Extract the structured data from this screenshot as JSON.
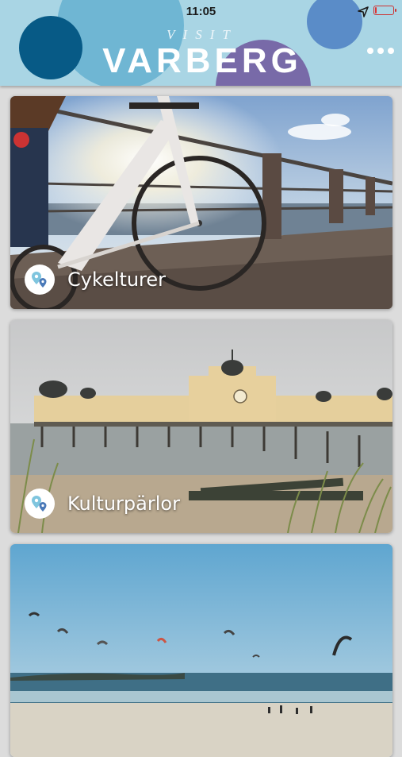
{
  "status_bar": {
    "time": "11:05"
  },
  "header": {
    "logo_small": "VISIT",
    "logo_main": "VARBERG"
  },
  "cards": [
    {
      "title": "Cykelturer",
      "icon": "map-pin-icon"
    },
    {
      "title": "Kulturpärlor",
      "icon": "map-pin-icon"
    },
    {
      "title": "",
      "icon": ""
    }
  ],
  "colors": {
    "header_bg": "#a9d5e4",
    "accent_dark_blue": "#075a86",
    "accent_purple": "#786aa8",
    "battery_low": "#d33"
  },
  "battery_level": 0.1
}
